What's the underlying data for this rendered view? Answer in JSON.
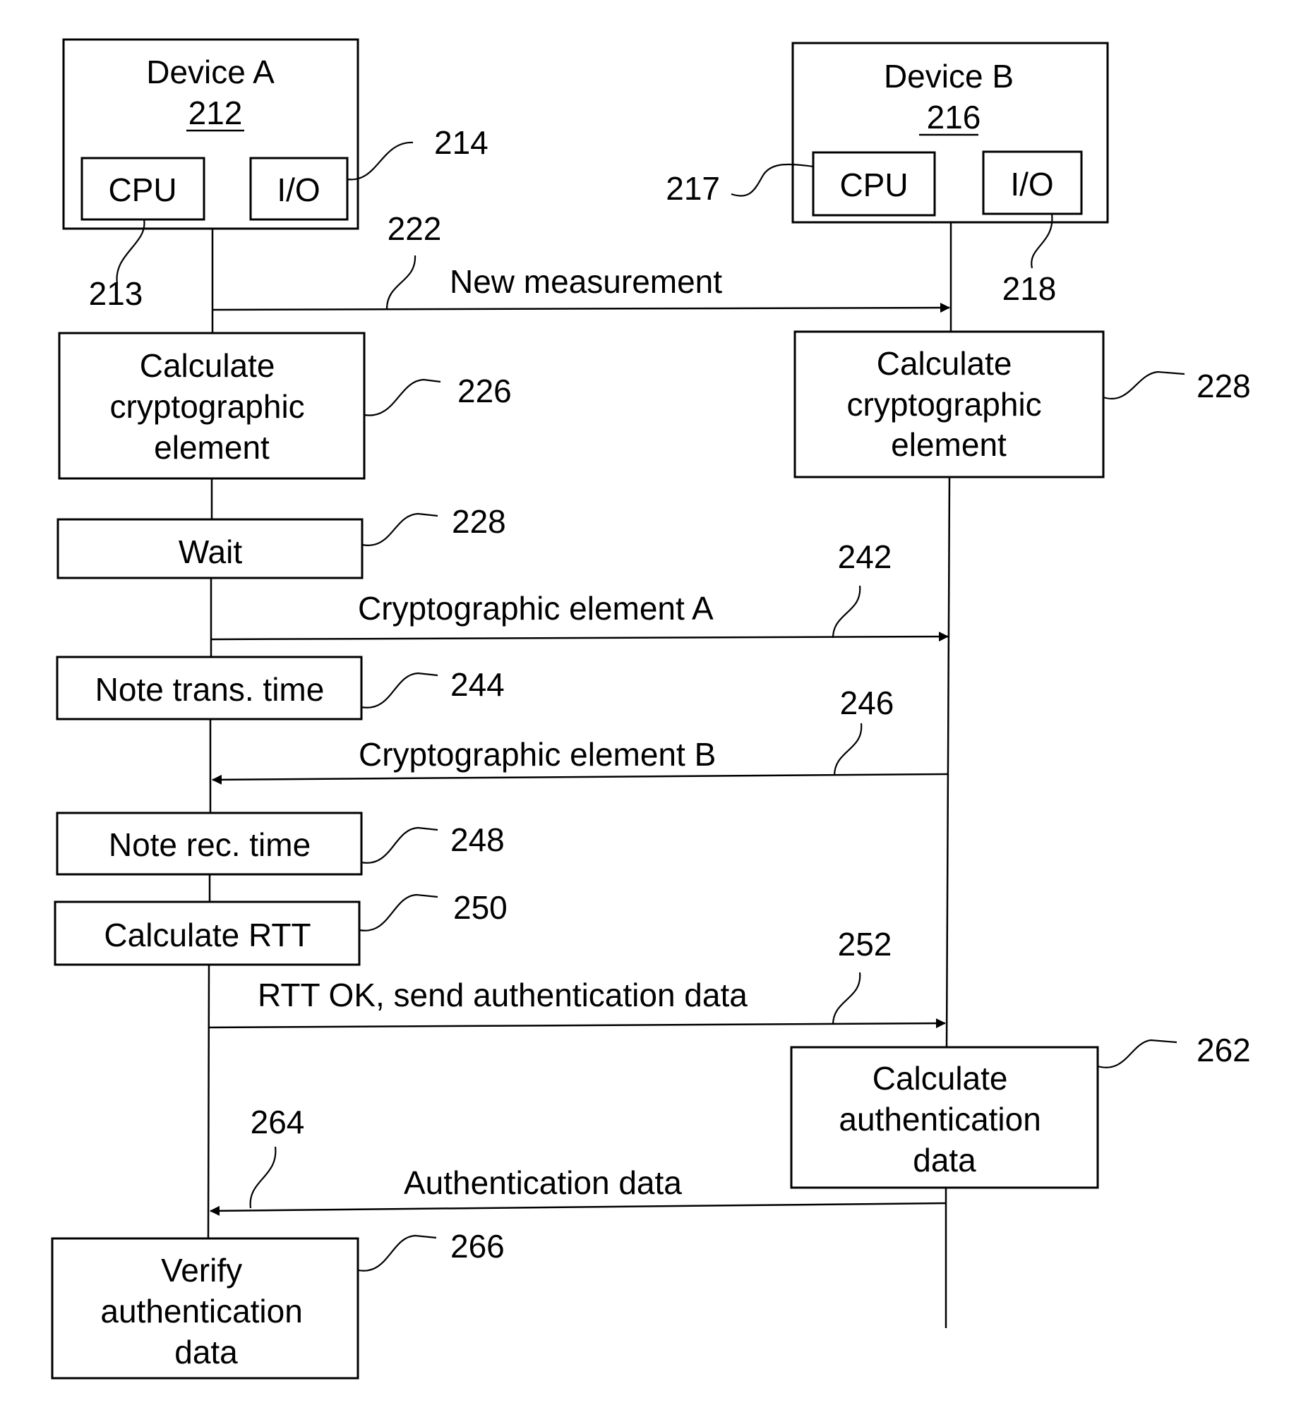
{
  "devices": [
    {
      "name": "Device A",
      "ref": "212",
      "cpu_label": "CPU",
      "cpu_ref": "213",
      "io_label": "I/O",
      "io_ref": "214"
    },
    {
      "name": "Device B",
      "ref": "216",
      "cpu_label": "CPU",
      "cpu_ref": "217",
      "io_label": "I/O",
      "io_ref": "218"
    }
  ],
  "steps": [
    {
      "id": "calc-crypto-a",
      "lines": [
        "Calculate",
        "cryptographic",
        "element"
      ],
      "ref": "226",
      "side": "A"
    },
    {
      "id": "calc-crypto-b",
      "lines": [
        "Calculate",
        "cryptographic",
        "element"
      ],
      "ref": "228",
      "side": "B"
    },
    {
      "id": "wait",
      "lines": [
        "Wait"
      ],
      "ref": "228",
      "side": "A"
    },
    {
      "id": "note-trans-time",
      "lines": [
        "Note trans. time"
      ],
      "ref": "244",
      "side": "A"
    },
    {
      "id": "note-rec-time",
      "lines": [
        "Note rec. time"
      ],
      "ref": "248",
      "side": "A"
    },
    {
      "id": "calc-rtt",
      "lines": [
        "Calculate RTT"
      ],
      "ref": "250",
      "side": "A"
    },
    {
      "id": "calc-auth-b",
      "lines": [
        "Calculate",
        "authentication",
        "data"
      ],
      "ref": "262",
      "side": "B"
    },
    {
      "id": "verify-auth",
      "lines": [
        "Verify",
        "authentication",
        "data"
      ],
      "ref": "266",
      "side": "A"
    }
  ],
  "messages": [
    {
      "label": "New measurement",
      "ref": "222",
      "direction": "A→B"
    },
    {
      "label": "Cryptographic element A",
      "ref": "242",
      "direction": "A→B"
    },
    {
      "label": "Cryptographic element B",
      "ref": "246",
      "direction": "B→A"
    },
    {
      "label": "RTT OK, send authentication data",
      "ref": "252",
      "direction": "A→B"
    },
    {
      "label": "Authentication data",
      "ref": "264",
      "direction": "B→A"
    }
  ]
}
